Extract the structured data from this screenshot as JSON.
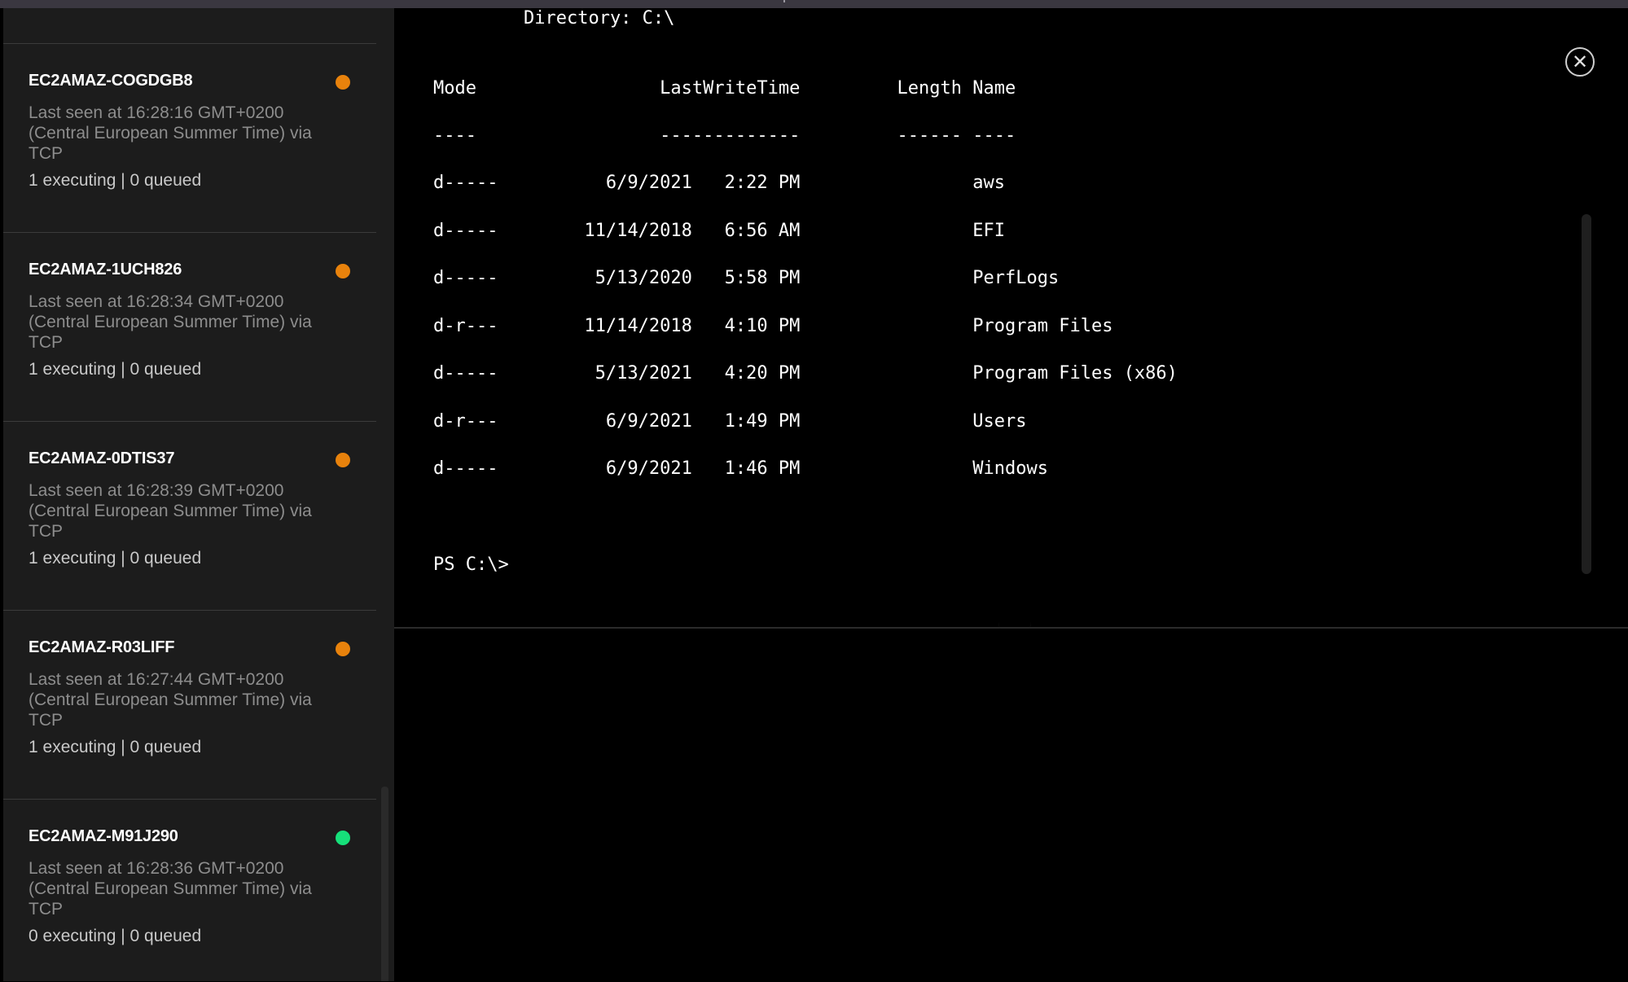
{
  "agents": [
    {
      "name": "EC2AMAZ-COGDGB8",
      "last_seen": "Last seen at 16:28:16 GMT+0200 (Central European Summer Time) via TCP",
      "queue": "1 executing | 0 queued",
      "status_color": "#e8820c"
    },
    {
      "name": "EC2AMAZ-1UCH826",
      "last_seen": "Last seen at 16:28:34 GMT+0200 (Central European Summer Time) via TCP",
      "queue": "1 executing | 0 queued",
      "status_color": "#e8820c"
    },
    {
      "name": "EC2AMAZ-0DTIS37",
      "last_seen": "Last seen at 16:28:39 GMT+0200 (Central European Summer Time) via TCP",
      "queue": "1 executing | 0 queued",
      "status_color": "#e8820c"
    },
    {
      "name": "EC2AMAZ-R03LIFF",
      "last_seen": "Last seen at 16:27:44 GMT+0200 (Central European Summer Time) via TCP",
      "queue": "1 executing | 0 queued",
      "status_color": "#e8820c"
    },
    {
      "name": "EC2AMAZ-M91J290",
      "last_seen": "Last seen at 16:28:36 GMT+0200 (Central European Summer Time) via TCP",
      "queue": "0 executing | 0 queued",
      "status_color": "#16e07a"
    }
  ],
  "terminal": {
    "directory_line": "    Directory: C:\\",
    "header_line": "Mode                 LastWriteTime         Length Name",
    "underline_line": "----                 -------------         ------ ----",
    "rows": [
      "d-----          6/9/2021   2:22 PM                aws",
      "d-----        11/14/2018   6:56 AM                EFI",
      "d-----         5/13/2020   5:58 PM                PerfLogs",
      "d-r---        11/14/2018   4:10 PM                Program Files",
      "d-----         5/13/2021   4:20 PM                Program Files (x86)",
      "d-r---          6/9/2021   1:49 PM                Users",
      "d-----          6/9/2021   1:46 PM                Windows"
    ],
    "prompt": "PS C:\\>"
  },
  "close_button": {
    "glyph": "✕",
    "icon": "close-circle-icon"
  }
}
